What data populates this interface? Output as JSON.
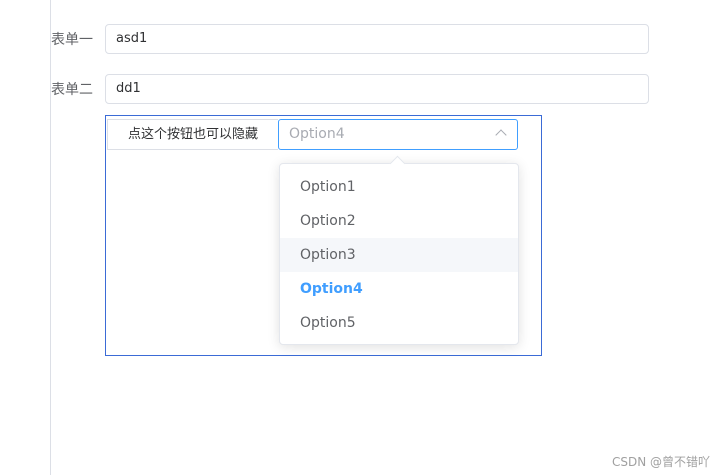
{
  "form": {
    "field1": {
      "label": "表单一",
      "value": "asd1"
    },
    "field2": {
      "label": "表单二",
      "value": "dd1"
    }
  },
  "panel": {
    "hide_button_label": "点这个按钮也可以隐藏",
    "select": {
      "value": "Option4",
      "icon": "chevron-up-icon"
    },
    "dropdown": {
      "options": [
        "Option1",
        "Option2",
        "Option3",
        "Option4",
        "Option5"
      ],
      "hovered": "Option3",
      "selected": "Option4"
    }
  },
  "watermark": "CSDN @曾不错吖",
  "colors": {
    "accent": "#409eff",
    "panel_border": "#3b6bd6",
    "border": "#dcdfe6"
  }
}
